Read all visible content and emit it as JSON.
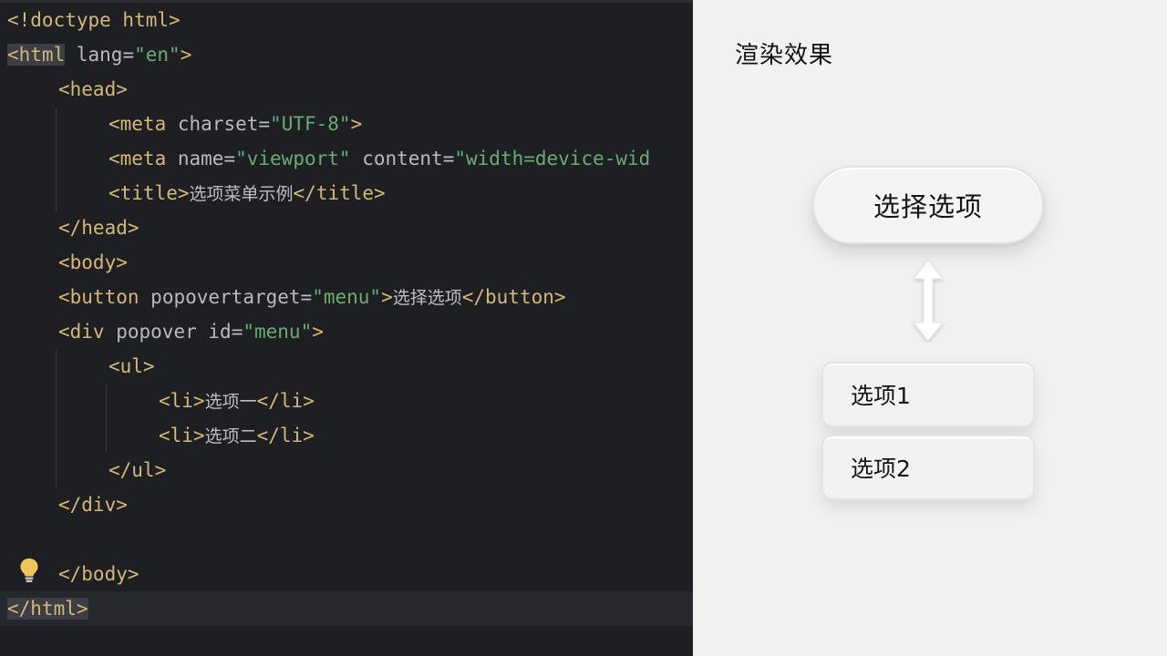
{
  "editor": {
    "line1": {
      "open": "<!doctype html>"
    },
    "line2": {
      "tag": "<html",
      "attr": "lang",
      "eq": "=",
      "val": "\"en\"",
      "close": ">"
    },
    "line3": {
      "text": "<head>"
    },
    "line4": {
      "tag": "<meta",
      "attr": "charset",
      "eq": "=",
      "val": "\"UTF-8\"",
      "close": ">"
    },
    "line5": {
      "tag": "<meta",
      "attr1": "name",
      "eq1": "=",
      "val1": "\"viewport\"",
      "attr2": "content",
      "eq2": "=",
      "val2": "\"width=device-wid"
    },
    "line6": {
      "open": "<title>",
      "content": "选项菜单示例",
      "close": "</title>"
    },
    "line7": {
      "text": "</head>"
    },
    "line8": {
      "text": "<body>"
    },
    "line9": {
      "tag": "<button",
      "attr": "popovertarget",
      "eq": "=",
      "val": "\"menu\"",
      "gt": ">",
      "content": "选择选项",
      "close": "</button>"
    },
    "line10": {
      "tag": "<div",
      "attr1": "popover",
      "attr2": "id",
      "eq": "=",
      "val": "\"menu\"",
      "close": ">"
    },
    "line11": {
      "text": "<ul>"
    },
    "line12": {
      "open": "<li>",
      "content": "选项一",
      "close": "</li>"
    },
    "line13": {
      "open": "<li>",
      "content": "选项二",
      "close": "</li>"
    },
    "line14": {
      "text": "</ul>"
    },
    "line15": {
      "text": "</div>"
    },
    "line17": {
      "text": "</body>"
    },
    "line18": {
      "text": "</html>"
    }
  },
  "preview": {
    "title": "渲染效果",
    "button_label": "选择选项",
    "menu_items": [
      "选项1",
      "选项2"
    ]
  },
  "icons": {
    "lightbulb": "lightbulb-icon",
    "arrow": "double-arrow-icon"
  }
}
